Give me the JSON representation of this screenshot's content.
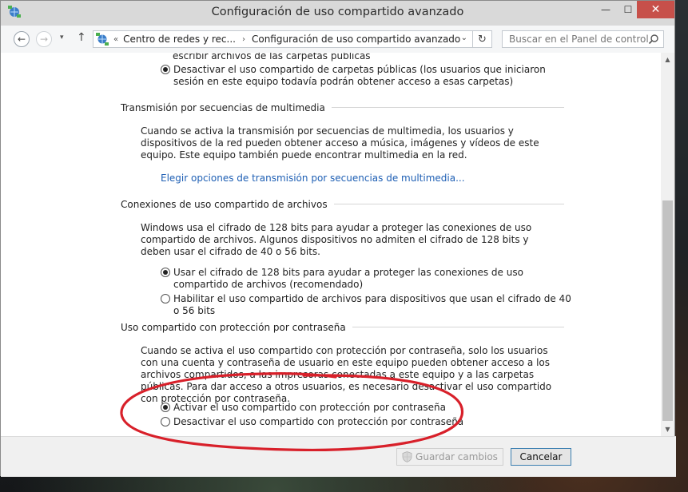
{
  "window": {
    "title": "Configuración de uso compartido avanzado",
    "min_glyph": "—",
    "max_glyph": "☐",
    "close_glyph": "✕"
  },
  "nav": {
    "back_glyph": "←",
    "forward_glyph": "→",
    "recent_glyph": "▾",
    "up_glyph": "↑",
    "breadcrumb_overflow": "«",
    "breadcrumb": [
      "Centro de redes y rec...",
      "Configuración de uso compartido avanzado"
    ],
    "breadcrumb_sep": "›",
    "address_dropdown_glyph": "⌄",
    "refresh_glyph": "↻",
    "search_placeholder": "Buscar en el Panel de control"
  },
  "public_folders": {
    "cut_text": "escribir archivos de las carpetas públicas",
    "disable_option": "Desactivar el uso compartido de carpetas públicas (los usuarios que iniciaron sesión en este equipo todavía podrán obtener acceso a esas carpetas)"
  },
  "media_streaming": {
    "title": "Transmisión por secuencias de multimedia",
    "description": "Cuando se activa la transmisión por secuencias de multimedia, los usuarios y dispositivos de la red pueden obtener acceso a música, imágenes y vídeos de este equipo. Este equipo también puede encontrar multimedia en la red.",
    "link": "Elegir opciones de transmisión por secuencias de multimedia..."
  },
  "file_sharing": {
    "title": "Conexiones de uso compartido de archivos",
    "description": "Windows usa el cifrado de 128 bits para ayudar a proteger las conexiones de uso compartido de archivos. Algunos dispositivos no admiten el cifrado de 128 bits y deben usar el cifrado de 40 o 56 bits.",
    "option_128": "Usar el cifrado de 128 bits para ayudar a proteger las conexiones de uso compartido de archivos (recomendado)",
    "option_40_56": "Habilitar el uso compartido de archivos para dispositivos que usan el cifrado de 40 o 56 bits"
  },
  "password_sharing": {
    "title": "Uso compartido con protección por contraseña",
    "description": "Cuando se activa el uso compartido con protección por contraseña, solo los usuarios con una cuenta y contraseña de usuario en este equipo pueden obtener acceso a los archivos compartidos, a las impresoras conectadas a este equipo y a las carpetas públicas. Para dar acceso a otros usuarios, es necesario desactivar el uso compartido con protección por contraseña.",
    "option_on": "Activar el uso compartido con protección por contraseña",
    "option_off": "Desactivar el uso compartido con protección por contraseña"
  },
  "footer": {
    "save_label": "Guardar cambios",
    "cancel_label": "Cancelar"
  },
  "scrollbar": {
    "up_glyph": "▲",
    "down_glyph": "▼"
  },
  "colors": {
    "link": "#1e5fb4",
    "annotation_red": "#d8202a",
    "close_button": "#c7504a"
  }
}
